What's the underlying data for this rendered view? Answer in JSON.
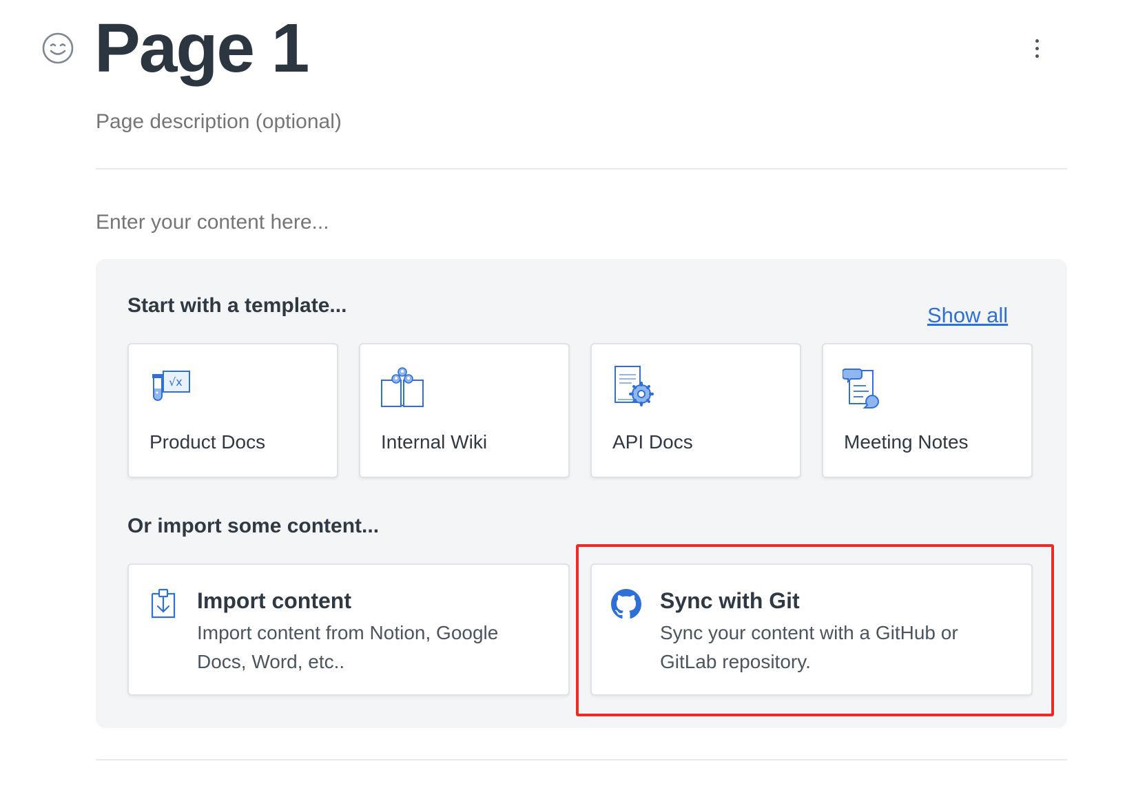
{
  "header": {
    "title": "Page 1",
    "emoji_icon": "smiley-face-icon",
    "more_icon": "vertical-ellipsis-icon"
  },
  "description": {
    "placeholder": "Page description (optional)"
  },
  "editor": {
    "placeholder": "Enter your content here..."
  },
  "templates": {
    "heading": "Start with a template...",
    "show_all_label": "Show all",
    "items": [
      {
        "label": "Product Docs",
        "icon": "flask-formula-icon"
      },
      {
        "label": "Internal Wiki",
        "icon": "open-book-people-icon"
      },
      {
        "label": "API Docs",
        "icon": "document-gear-icon"
      },
      {
        "label": "Meeting Notes",
        "icon": "notes-chat-bubbles-icon"
      }
    ]
  },
  "import": {
    "heading": "Or import some content...",
    "items": [
      {
        "title": "Import content",
        "description": "Import content from Notion, Google Docs, Word, etc..",
        "icon": "clipboard-download-icon"
      },
      {
        "title": "Sync with Git",
        "description": "Sync your content with a GitHub or GitLab repository.",
        "icon": "github-icon"
      }
    ]
  },
  "colors": {
    "accent": "#2f6fd8",
    "highlight": "#ee2a24",
    "panel_bg": "#f4f5f7"
  }
}
